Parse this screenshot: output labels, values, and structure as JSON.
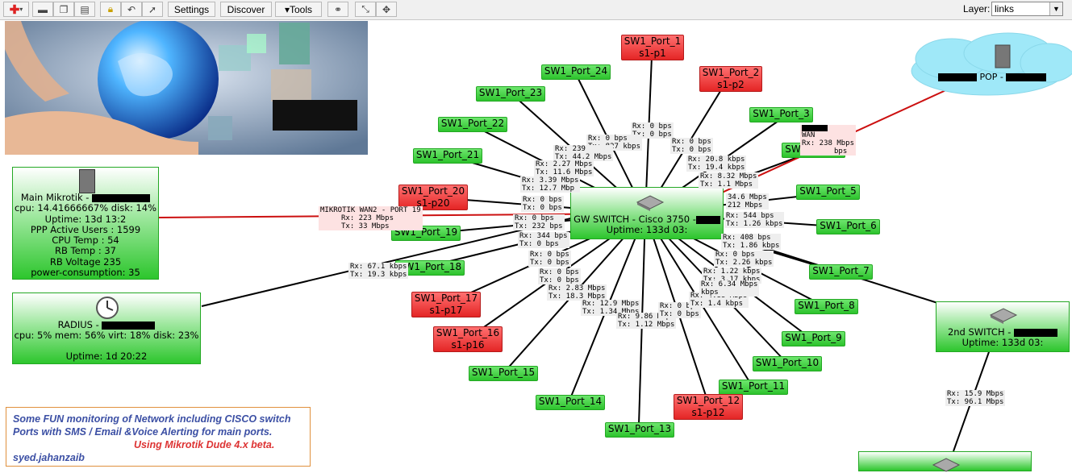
{
  "toolbar": {
    "settings": "Settings",
    "discover": "Discover",
    "tools": "▾Tools",
    "layer_label": "Layer:",
    "layer_value": "links"
  },
  "nodes": {
    "p1": {
      "name": "SW1_Port_1",
      "sub": "s1-p1",
      "color": "red"
    },
    "p2": {
      "name": "SW1_Port_2",
      "sub": "s1-p2",
      "color": "red"
    },
    "p3": {
      "name": "SW1_Port_3",
      "color": "green"
    },
    "p4": {
      "name": "SW1_Port_4",
      "color": "green"
    },
    "p5": {
      "name": "SW1_Port_5",
      "color": "green"
    },
    "p6": {
      "name": "SW1_Port_6",
      "color": "green"
    },
    "p7": {
      "name": "SW1_Port_7",
      "color": "green"
    },
    "p8": {
      "name": "SW1_Port_8",
      "color": "green"
    },
    "p9": {
      "name": "SW1_Port_9",
      "color": "green"
    },
    "p10": {
      "name": "SW1_Port_10",
      "color": "green"
    },
    "p11": {
      "name": "SW1_Port_11",
      "color": "green"
    },
    "p12": {
      "name": "SW1_Port_12",
      "sub": "s1-p12",
      "color": "red"
    },
    "p13": {
      "name": "SW1_Port_13",
      "color": "green"
    },
    "p14": {
      "name": "SW1_Port_14",
      "color": "green"
    },
    "p15": {
      "name": "SW1_Port_15",
      "color": "green"
    },
    "p16": {
      "name": "SW1_Port_16",
      "sub": "s1-p16",
      "color": "red"
    },
    "p17": {
      "name": "SW1_Port_17",
      "sub": "s1-p17",
      "color": "red"
    },
    "p18": {
      "name": "SW1_Port_18",
      "color": "green"
    },
    "p19": {
      "name": "SW1_Port_19",
      "color": "green"
    },
    "p20": {
      "name": "SW1_Port_20",
      "sub": "s1-p20",
      "color": "red"
    },
    "p21": {
      "name": "SW1_Port_21",
      "color": "green"
    },
    "p22": {
      "name": "SW1_Port_22",
      "color": "green"
    },
    "p23": {
      "name": "SW1_Port_23",
      "color": "green"
    },
    "p24": {
      "name": "SW1_Port_24",
      "color": "green"
    }
  },
  "gw_switch": {
    "name": "GW SWITCH - Cisco 3750 -",
    "uptime": "Uptime: 133d 03:"
  },
  "second_switch": {
    "name": "2nd SWITCH -",
    "uptime": "Uptime: 133d 03:"
  },
  "main_mikrotik": {
    "name": "Main Mikrotik -",
    "cpu": "cpu: 14.41666667% disk: 14%",
    "uptime": "Uptime: 13d 13:2",
    "ppp": "PPP Active Users :  1599",
    "cpu_temp": "CPU Temp :  54",
    "rb_temp": "RB Temp :  37",
    "rb_voltage": "RB Voltage 235",
    "power": "power-consumption:  35"
  },
  "radius": {
    "name": "RADIUS -",
    "stats": "cpu: 5% mem: 56% virt: 18% disk: 23%",
    "uptime": "Uptime: 1d 20:22"
  },
  "pop": {
    "name": "POP -"
  },
  "link_labels": {
    "wan2_title": "MIKROTIK WAN2 - PORT 19",
    "wan2_rx": "Rx: 223 Mbps",
    "wan2_tx": "Tx: 33 Mbps",
    "wan_title": "WAN",
    "wan_rx": "Rx: 238 Mbps",
    "wan_tx": "bps",
    "radius_rx": "Rx: 67.1 kbps",
    "radius_tx": "Tx: 19.3 kbps",
    "sw2_rx": "Rx: 15.9 Mbps",
    "sw2_tx": "Tx: 96.1 Mbps"
  },
  "port_stats": [
    {
      "rx": "Rx: 0 bps",
      "tx": "Tx: 0 bps"
    },
    {
      "rx": "Rx: 0 bps",
      "tx": "Tx: 827 kbps"
    },
    {
      "rx": "Rx: 0 bps",
      "tx": "Tx: 0 bps"
    },
    {
      "rx": "Rx: 20.8 kbps",
      "tx": "Tx: 19.4 kbps"
    },
    {
      "rx": "Rx: 8.32 Mbps",
      "tx": "Tx: 1.1 Mbps"
    },
    {
      "rx": "Rx: 239",
      "tx": "Tx: 44.2 Mbps"
    },
    {
      "rx": "Rx: 2.27 Mbps",
      "tx": "Tx: 11.6 Mbps"
    },
    {
      "rx": "Rx: 3.39 Mbps",
      "tx": "Tx: 12.7 Mbp"
    },
    {
      "rx": "Rx: 0 bps",
      "tx": "Tx: 0 bps"
    },
    {
      "rx": "Rx: 0 bps",
      "tx": "Tx: 232 bps"
    },
    {
      "rx": "Rx: 344 bps",
      "tx": "Tx: 0 bps"
    },
    {
      "rx": "Rx: 0 bps",
      "tx": "Tx: 0 bps"
    },
    {
      "rx": "Rx: 0 bps",
      "tx": "Tx: 0 bps"
    },
    {
      "rx": "Rx: 2.83 Mbps",
      "tx": "Tx: 18.3 Mbps"
    },
    {
      "rx": "Rx: 12.9 Mbps",
      "tx": "Tx: 1.34 Mbps"
    },
    {
      "rx": "Rx: 9.86 Mbps",
      "tx": "Tx: 1.12 Mbps"
    },
    {
      "rx": "Rx: 0 bps",
      "tx": "Tx: 0 bps"
    },
    {
      "rx": "Rx: 4.88 Mbps",
      "tx": "Tx: 1.4 kbps"
    },
    {
      "rx": "Rx: 1.22 kbps",
      "tx": "Tx: 3.17 kbps"
    },
    {
      "rx": "Rx: 0 bps",
      "tx": "Tx: 2.26 kbps"
    },
    {
      "rx": "Rx: 408 bps",
      "tx": "Tx: 1.86 kbps"
    },
    {
      "rx": "Rx: 544 bps",
      "tx": "Tx: 1.26 kbps"
    },
    {
      "rx": "34.6 Mbps",
      "tx": "212 Mbps"
    },
    {
      "rx": "Rx: 6.34 Mbps",
      "tx": "kbps"
    }
  ],
  "note": {
    "line1": "Some FUN monitoring of Network including CISCO switch",
    "line2": "Ports with SMS / Email &Voice Alerting for main ports.",
    "line3": "Using Mikrotik Dude 4.x beta.",
    "line4": "syed.jahanzaib"
  },
  "colors": {
    "green": "#2cc32c",
    "red": "#e42525",
    "link_red": "#cc1010",
    "note_blue": "#3b4fa4",
    "cloud": "#9fe8f8"
  }
}
